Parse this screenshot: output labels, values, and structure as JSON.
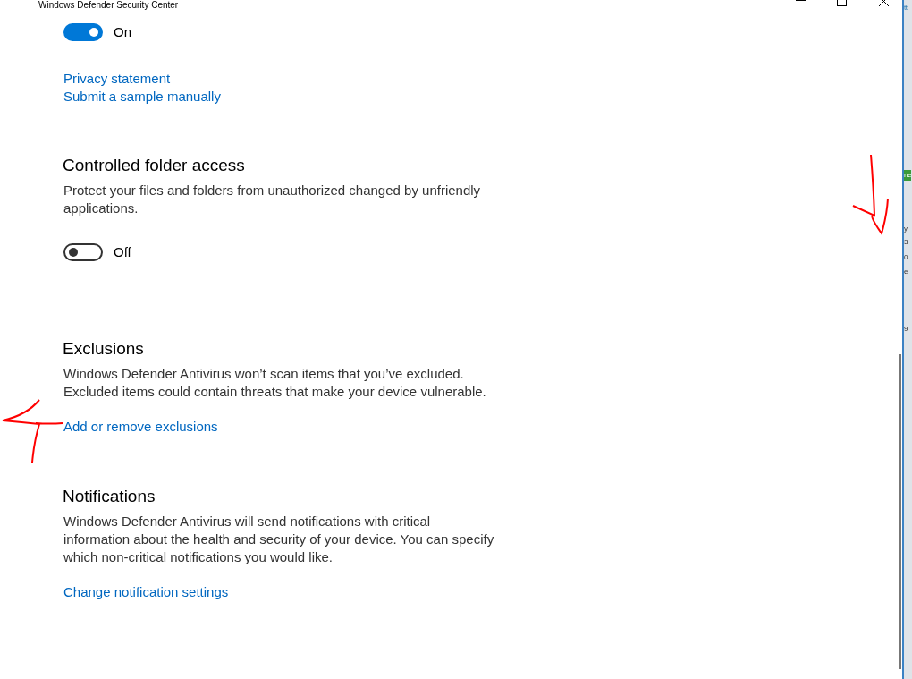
{
  "window": {
    "title": "Windows Defender Security Center"
  },
  "top_toggle": {
    "on": true,
    "label": "On"
  },
  "links": [
    "Privacy statement",
    "Submit a sample manually"
  ],
  "sections": [
    {
      "kind": "toggle",
      "heading": "Controlled folder access",
      "description": "Protect your files and folders from unauthorized changed by unfriendly applications.",
      "toggle": {
        "on": false,
        "label": "Off"
      }
    },
    {
      "kind": "link",
      "heading": "Exclusions",
      "description": "Windows Defender Antivirus won’t scan items that you’ve excluded. Excluded items could contain threats that make your device vulnerable.",
      "link": "Add or remove exclusions"
    },
    {
      "kind": "link",
      "heading": "Notifications",
      "description": "Windows Defender Antivirus will send notifications with critical information about the health and security of your device.  You can specify which non-critical notifications you would like.",
      "link": "Change notification settings"
    }
  ],
  "background_window": {
    "fragments": [
      "tt",
      "ne",
      "y",
      "3",
      "0",
      "e",
      "9"
    ]
  }
}
